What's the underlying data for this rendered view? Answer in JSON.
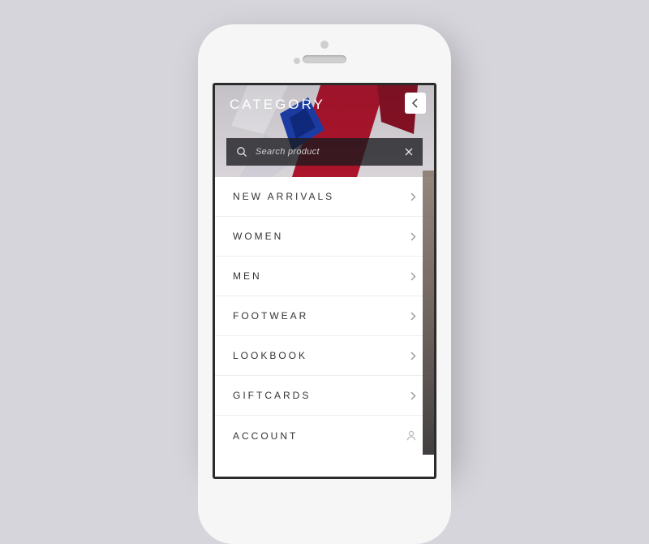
{
  "header": {
    "title": "CATEGORY"
  },
  "search": {
    "placeholder": "Search product"
  },
  "menu": {
    "items": [
      {
        "label": "NEW ARRIVALS",
        "icon": "chevron"
      },
      {
        "label": "WOMEN",
        "icon": "chevron"
      },
      {
        "label": "MEN",
        "icon": "chevron"
      },
      {
        "label": "FOOTWEAR",
        "icon": "chevron"
      },
      {
        "label": "LOOKBOOK",
        "icon": "chevron"
      },
      {
        "label": "GIFTCARDS",
        "icon": "chevron"
      },
      {
        "label": "ACCOUNT",
        "icon": "user"
      }
    ]
  },
  "colors": {
    "hero_red": "#b3132b",
    "hero_blue": "#1b3fb0",
    "divider": "#eeeeee",
    "text": "#333333"
  }
}
